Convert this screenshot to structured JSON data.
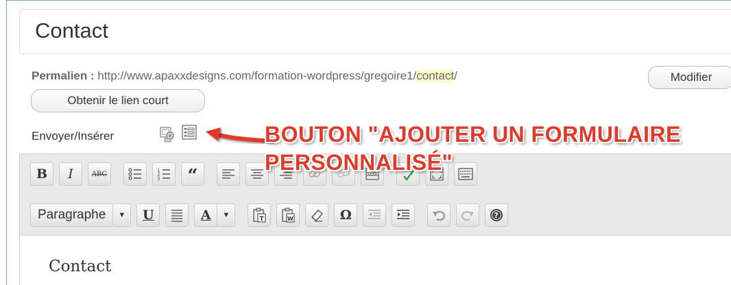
{
  "post": {
    "title": "Contact",
    "content": "Contact"
  },
  "permalink": {
    "label": "Permalien :",
    "url_prefix": " http://www.apaxxdesigns.com/formation-wordpress/gregoire1/",
    "slug": "contact",
    "url_suffix": "/",
    "edit_button": "Modifier",
    "shortlink_button": "Obtenir le lien court"
  },
  "media": {
    "label": "Envoyer/Insérer",
    "icons": [
      "media-upload-icon",
      "add-form-icon"
    ]
  },
  "annotation": {
    "line1": "BOUTON \"AJOUTER UN FORMULAIRE",
    "line2": "PERSONNALISÉ\"",
    "color": "#e03a2a"
  },
  "toolbar": {
    "row1": {
      "bold": "B",
      "italic": "I",
      "strike": "ABC",
      "blockquote": "“"
    },
    "row2": {
      "format_select": "Paragraphe",
      "underline": "U",
      "text_color": "A",
      "special_char": "Ω"
    }
  },
  "colors": {
    "frame_border": "#6fa0d8",
    "toolbar_bg": "#e9e9e9",
    "slug_highlight": "#fffbcc"
  }
}
